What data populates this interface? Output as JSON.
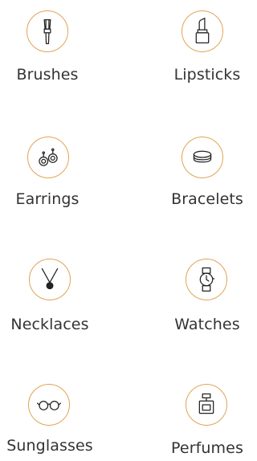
{
  "categories": [
    {
      "label": "Brushes",
      "icon": "brush-icon"
    },
    {
      "label": "Lipsticks",
      "icon": "lipstick-icon"
    },
    {
      "label": "Earrings",
      "icon": "earrings-icon"
    },
    {
      "label": "Bracelets",
      "icon": "bracelet-icon"
    },
    {
      "label": "Necklaces",
      "icon": "necklace-icon"
    },
    {
      "label": "Watches",
      "icon": "watch-icon"
    },
    {
      "label": "Sunglasses",
      "icon": "sunglasses-icon"
    },
    {
      "label": "Perfumes",
      "icon": "perfume-icon"
    }
  ],
  "colors": {
    "accent": "#e0a456",
    "text": "#333333",
    "icon": "#222222"
  }
}
